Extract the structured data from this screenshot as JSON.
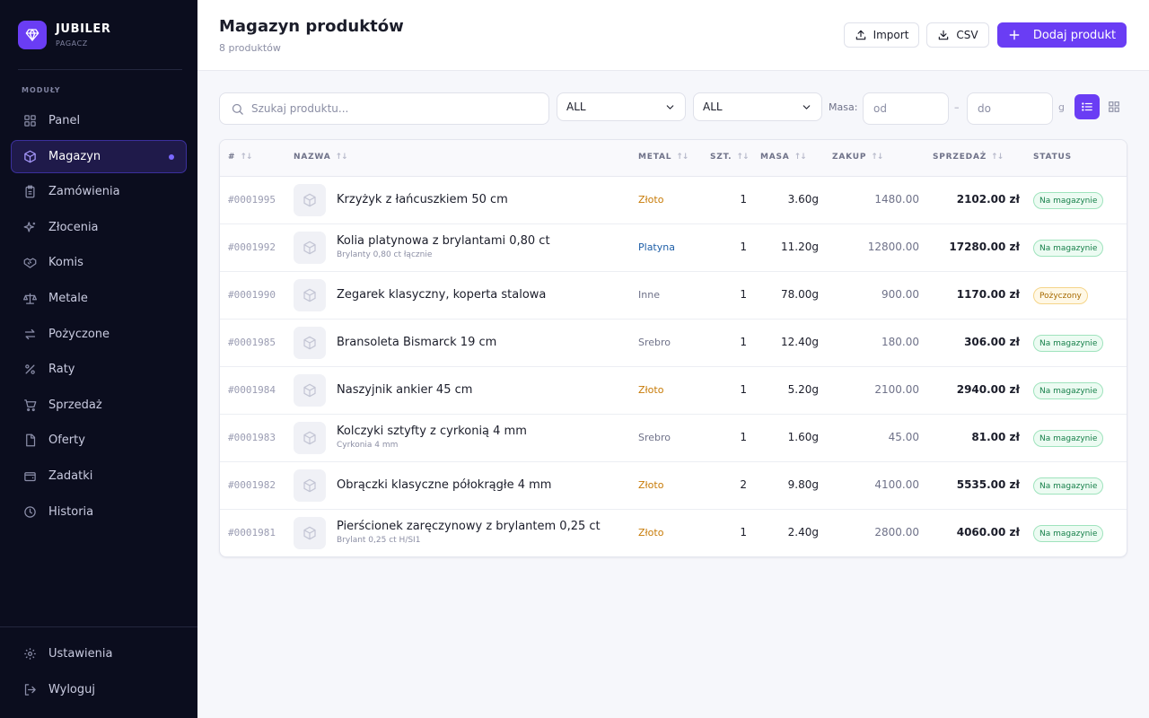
{
  "brand": {
    "name": "JUBILER",
    "subtitle": "PAGACZ"
  },
  "sidebar": {
    "section_label": "MODUŁY",
    "items": [
      {
        "label": "Panel",
        "icon": "grid-icon"
      },
      {
        "label": "Magazyn",
        "icon": "box-icon",
        "active": true
      },
      {
        "label": "Zamówienia",
        "icon": "clipboard-icon"
      },
      {
        "label": "Złocenia",
        "icon": "sparkles-icon"
      },
      {
        "label": "Komis",
        "icon": "handshake-icon"
      },
      {
        "label": "Metale",
        "icon": "scale-icon"
      },
      {
        "label": "Pożyczone",
        "icon": "arrows-swap-icon"
      },
      {
        "label": "Raty",
        "icon": "percent-icon"
      },
      {
        "label": "Sprzedaż",
        "icon": "cart-icon"
      },
      {
        "label": "Oferty",
        "icon": "document-icon"
      },
      {
        "label": "Zadatki",
        "icon": "wallet-icon"
      },
      {
        "label": "Historia",
        "icon": "history-icon"
      }
    ],
    "bottom": [
      {
        "label": "Ustawienia",
        "icon": "gear-icon"
      },
      {
        "label": "Wyloguj",
        "icon": "logout-icon"
      }
    ]
  },
  "header": {
    "title": "Magazyn produktów",
    "subtitle": "8 produktów",
    "import_label": "Import",
    "csv_label": "CSV",
    "add_label": "Dodaj produkt"
  },
  "filters": {
    "search_placeholder": "Szukaj produktu...",
    "metal_select": "ALL",
    "status_select": "ALL",
    "mass_label": "Masa:",
    "mass_from_placeholder": "od",
    "mass_dash": "–",
    "mass_to_placeholder": "do",
    "mass_unit": "g"
  },
  "table": {
    "columns": [
      "#",
      "NAZWA",
      "METAL",
      "SZT.",
      "MASA",
      "ZAKUP",
      "SPRZEDAŻ",
      "STATUS"
    ],
    "rows": [
      {
        "id": "#0001995",
        "name": "Krzyżyk z łańcuszkiem 50 cm",
        "note": "",
        "metal": "Złoto",
        "qty": "1",
        "mass": "3.60g",
        "buy": "1480.00",
        "sell": "2102.00 zł",
        "status": "Na magazynie"
      },
      {
        "id": "#0001992",
        "name": "Kolia platynowa z brylantami 0,80 ct",
        "note": "Brylanty 0,80 ct łącznie",
        "metal": "Platyna",
        "qty": "1",
        "mass": "11.20g",
        "buy": "12800.00",
        "sell": "17280.00 zł",
        "status": "Na magazynie"
      },
      {
        "id": "#0001990",
        "name": "Zegarek klasyczny, koperta stalowa",
        "note": "",
        "metal": "Inne",
        "qty": "1",
        "mass": "78.00g",
        "buy": "900.00",
        "sell": "1170.00 zł",
        "status": "Pożyczony"
      },
      {
        "id": "#0001985",
        "name": "Bransoleta Bismarck 19 cm",
        "note": "",
        "metal": "Srebro",
        "qty": "1",
        "mass": "12.40g",
        "buy": "180.00",
        "sell": "306.00 zł",
        "status": "Na magazynie"
      },
      {
        "id": "#0001984",
        "name": "Naszyjnik ankier 45 cm",
        "note": "",
        "metal": "Złoto",
        "qty": "1",
        "mass": "5.20g",
        "buy": "2100.00",
        "sell": "2940.00 zł",
        "status": "Na magazynie"
      },
      {
        "id": "#0001983",
        "name": "Kolczyki sztyfty z cyrkonią 4 mm",
        "note": "Cyrkonia 4 mm",
        "metal": "Srebro",
        "qty": "1",
        "mass": "1.60g",
        "buy": "45.00",
        "sell": "81.00 zł",
        "status": "Na magazynie"
      },
      {
        "id": "#0001982",
        "name": "Obrączki klasyczne półokrągłe 4 mm",
        "note": "",
        "metal": "Złoto",
        "qty": "2",
        "mass": "9.80g",
        "buy": "4100.00",
        "sell": "5535.00 zł",
        "status": "Na magazynie"
      },
      {
        "id": "#0001981",
        "name": "Pierścionek zaręczynowy z brylantem 0,25 ct",
        "note": "Brylant 0,25 ct H/SI1",
        "metal": "Złoto",
        "qty": "1",
        "mass": "2.40g",
        "buy": "2800.00",
        "sell": "4060.00 zł",
        "status": "Na magazynie"
      }
    ]
  },
  "colors": {
    "accent": "#6a3df4",
    "sidebar_bg": "#0b0d1e",
    "metal_gold": "#c77a06",
    "metal_platinum": "#1f5fa8",
    "metal_other": "#6f7289",
    "status_stock_bg": "#ecfbf2",
    "status_stock_border": "#9fe3bd",
    "status_stock_text": "#17804a",
    "status_loan_bg": "#fff8e6",
    "status_loan_border": "#f5d58a",
    "status_loan_text": "#a66a00"
  }
}
